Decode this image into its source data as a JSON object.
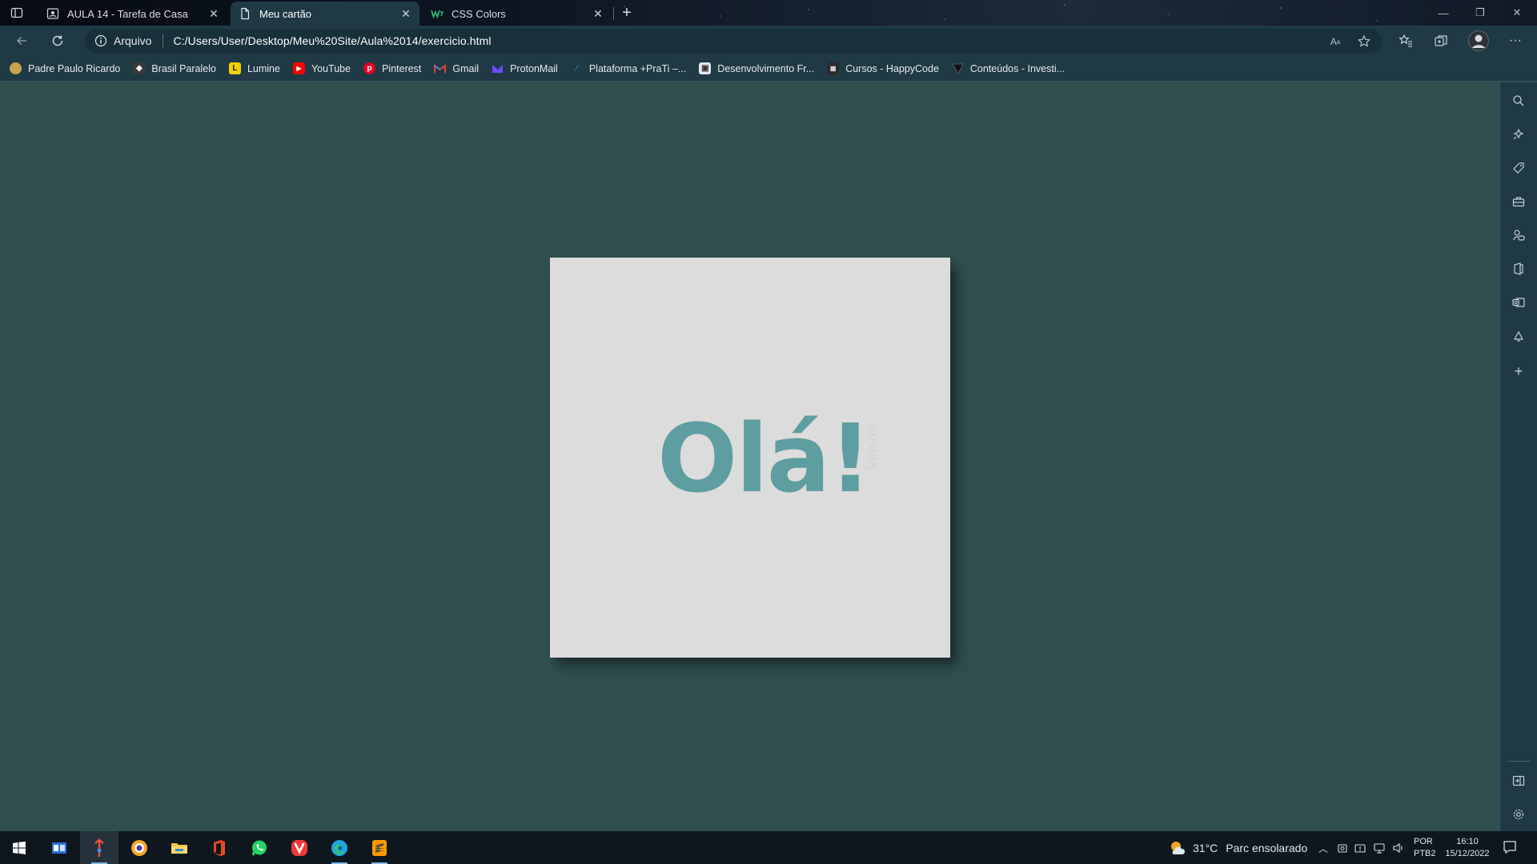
{
  "browser": {
    "tabs": [
      {
        "title": "AULA 14 - Tarefa de Casa",
        "icon": "person-page-icon",
        "active": false
      },
      {
        "title": "Meu cartão",
        "icon": "document-icon",
        "active": true
      },
      {
        "title": "CSS Colors",
        "icon": "w3-logo-icon",
        "active": false
      }
    ],
    "address": {
      "site_info_label": "Arquivo",
      "url": "C:/Users/User/Desktop/Meu%20Site/Aula%2014/exercicio.html"
    },
    "bookmarks": [
      {
        "label": "Padre Paulo Ricardo",
        "icon": "padre-icon",
        "color": "#c9a24a"
      },
      {
        "label": "Brasil Paralelo",
        "icon": "brasil-paralelo-icon",
        "color": "#3a3a3a"
      },
      {
        "label": "Lumine",
        "icon": "lumine-icon",
        "color": "#f2d000"
      },
      {
        "label": "YouTube",
        "icon": "youtube-icon",
        "color": "#ff0000"
      },
      {
        "label": "Pinterest",
        "icon": "pinterest-icon",
        "color": "#e60023"
      },
      {
        "label": "Gmail",
        "icon": "gmail-icon",
        "color": "#ea4335"
      },
      {
        "label": "ProtonMail",
        "icon": "protonmail-icon",
        "color": "#6d4aff"
      },
      {
        "label": "Plataforma +PraTi –...",
        "icon": "prati-icon",
        "color": "#3b6fd8"
      },
      {
        "label": "Desenvolvimento Fr...",
        "icon": "person-page-icon",
        "color": "#4a4f55"
      },
      {
        "label": "Cursos - HappyCode",
        "icon": "happycode-icon",
        "color": "#2b2b2b"
      },
      {
        "label": "Conteúdos - Investi...",
        "icon": "investi-icon",
        "color": "#1a1a1a"
      }
    ]
  },
  "card": {
    "greeting": "Olá!",
    "side_text": "Vire-me",
    "background_color": "#dcdcdc",
    "text_color": "#5f9ea0"
  },
  "page": {
    "background_color": "#2f4f4f"
  },
  "taskbar": {
    "weather": {
      "temperature": "31°C",
      "condition": "Parc ensolarado"
    },
    "language": {
      "line1": "POR",
      "line2": "PTB2"
    },
    "clock": {
      "time": "16:10",
      "date": "15/12/2022"
    },
    "apps": [
      "windows-start-icon",
      "task-view-icon",
      "git-icon",
      "brave-icon",
      "file-explorer-icon",
      "office-icon",
      "whatsapp-icon",
      "vivaldi-icon",
      "edge-icon",
      "sublime-text-icon"
    ]
  }
}
